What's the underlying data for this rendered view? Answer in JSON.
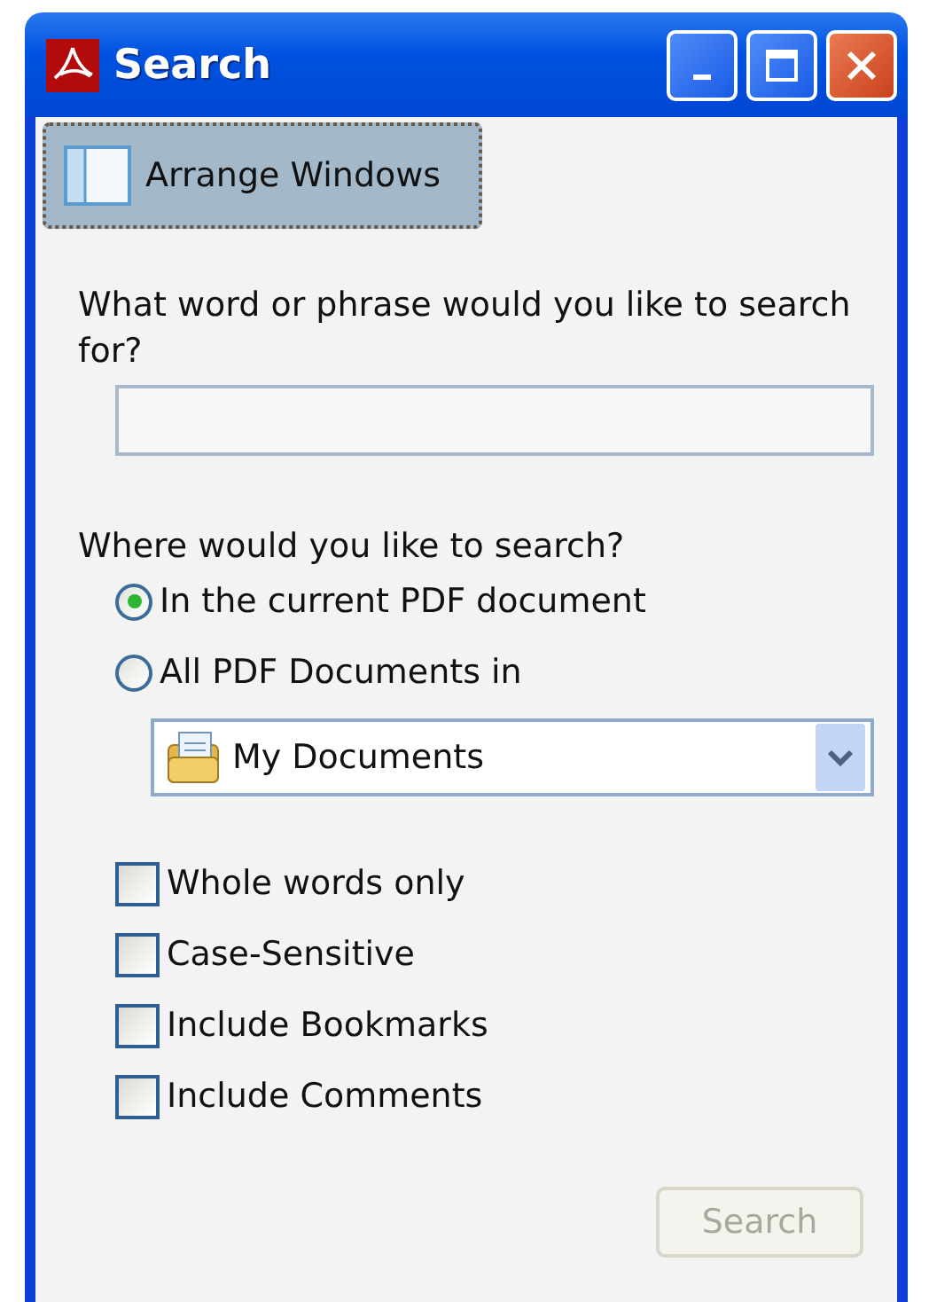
{
  "window": {
    "title": "Search"
  },
  "arrange_button": {
    "label": "Arrange Windows"
  },
  "question": "What word or phrase would you like to search for?",
  "location_prompt": "Where would you like to search?",
  "locations": [
    {
      "label": "In the current PDF document",
      "selected": true
    },
    {
      "label": "All PDF Documents in",
      "selected": false
    }
  ],
  "folder_dropdown": {
    "value": "My Documents"
  },
  "options": [
    {
      "label": "Whole words only",
      "checked": false
    },
    {
      "label": "Case-Sensitive",
      "checked": false
    },
    {
      "label": "Include Bookmarks",
      "checked": false
    },
    {
      "label": "Include Comments",
      "checked": false
    }
  ],
  "search_button": {
    "label": "Search",
    "disabled": true
  }
}
